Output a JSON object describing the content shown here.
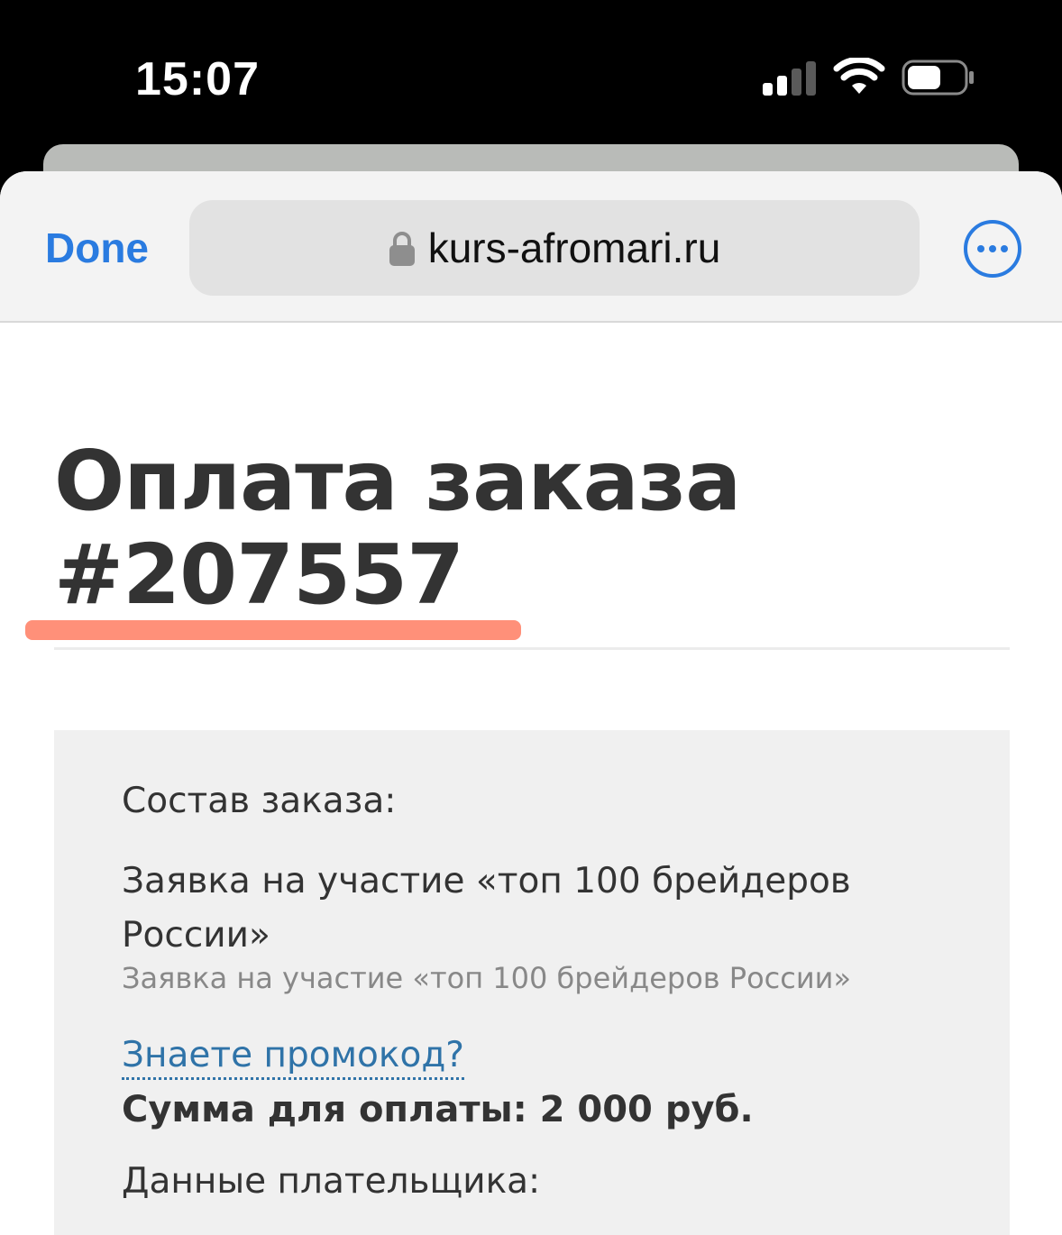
{
  "status_bar": {
    "time": "15:07",
    "icons": [
      "cellular-signal-icon",
      "wifi-icon",
      "battery-icon"
    ]
  },
  "browser": {
    "done_label": "Done",
    "url": "kurs-afromari.ru",
    "lock_icon": "lock-icon",
    "more_icon": "ellipsis-circle-icon",
    "accent_color": "#2a7be0"
  },
  "page": {
    "title": "Оплата заказа #207557",
    "highlight_color": "#ff8a72",
    "order": {
      "label": "Состав заказа:",
      "item_name": "Заявка на участие «топ 100 брейдеров России»",
      "item_description": "Заявка на участие «топ 100 брейдеров России»",
      "promo_link": "Знаете промокод?",
      "sum_text": "Сумма для оплаты: 2 000 руб.",
      "payer_label": "Данные плательщика:"
    }
  }
}
